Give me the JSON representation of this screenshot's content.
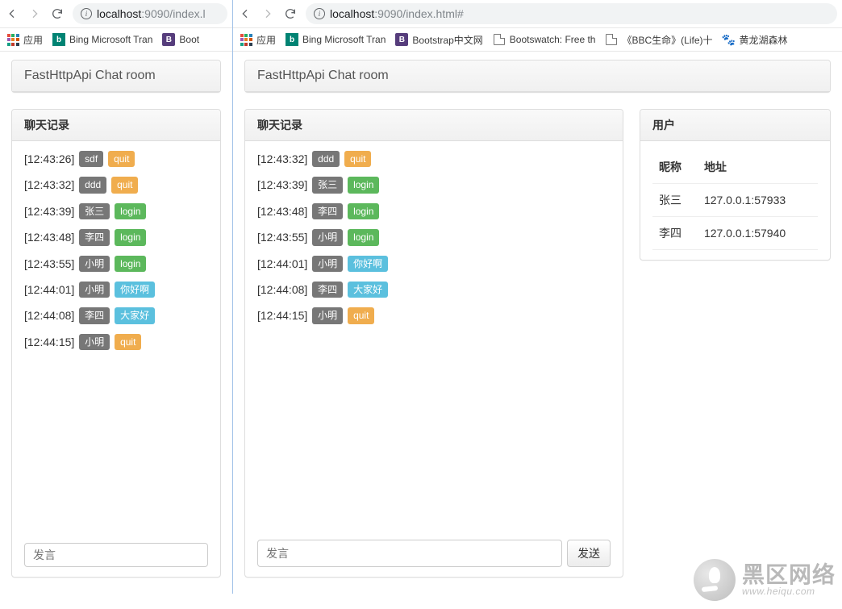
{
  "left": {
    "url_host": "localhost",
    "url_rest": ":9090/index.l",
    "bookmarks": [
      {
        "icon": "grid",
        "label": "应用"
      },
      {
        "icon": "bing",
        "label": "Bing Microsoft Tran"
      },
      {
        "icon": "B",
        "label": "Boot"
      }
    ],
    "title": "FastHttpApi Chat room",
    "chat_heading": "聊天记录",
    "messages": [
      {
        "time": "[12:43:26]",
        "user": "sdf",
        "action": "quit",
        "cls": "bg-orange"
      },
      {
        "time": "[12:43:32]",
        "user": "ddd",
        "action": "quit",
        "cls": "bg-orange"
      },
      {
        "time": "[12:43:39]",
        "user": "张三",
        "action": "login",
        "cls": "bg-green"
      },
      {
        "time": "[12:43:48]",
        "user": "李四",
        "action": "login",
        "cls": "bg-green"
      },
      {
        "time": "[12:43:55]",
        "user": "小明",
        "action": "login",
        "cls": "bg-green"
      },
      {
        "time": "[12:44:01]",
        "user": "小明",
        "action": "你好啊",
        "cls": "bg-cyan"
      },
      {
        "time": "[12:44:08]",
        "user": "李四",
        "action": "大家好",
        "cls": "bg-cyan"
      },
      {
        "time": "[12:44:15]",
        "user": "小明",
        "action": "quit",
        "cls": "bg-orange"
      }
    ],
    "input_placeholder": "发言"
  },
  "right": {
    "url_host": "localhost",
    "url_rest": ":9090/index.html#",
    "bookmarks": [
      {
        "icon": "grid",
        "label": "应用"
      },
      {
        "icon": "bing",
        "label": "Bing Microsoft Tran"
      },
      {
        "icon": "B",
        "label": "Bootstrap中文网"
      },
      {
        "icon": "doc",
        "label": "Bootswatch: Free th"
      },
      {
        "icon": "doc",
        "label": "《BBC生命》(Life)十"
      },
      {
        "icon": "paw",
        "label": "黄龙湖森林"
      }
    ],
    "title": "FastHttpApi Chat room",
    "chat_heading": "聊天记录",
    "users_heading": "用户",
    "messages": [
      {
        "time": "[12:43:32]",
        "user": "ddd",
        "action": "quit",
        "cls": "bg-orange"
      },
      {
        "time": "[12:43:39]",
        "user": "张三",
        "action": "login",
        "cls": "bg-green"
      },
      {
        "time": "[12:43:48]",
        "user": "李四",
        "action": "login",
        "cls": "bg-green"
      },
      {
        "time": "[12:43:55]",
        "user": "小明",
        "action": "login",
        "cls": "bg-green"
      },
      {
        "time": "[12:44:01]",
        "user": "小明",
        "action": "你好啊",
        "cls": "bg-cyan"
      },
      {
        "time": "[12:44:08]",
        "user": "李四",
        "action": "大家好",
        "cls": "bg-cyan"
      },
      {
        "time": "[12:44:15]",
        "user": "小明",
        "action": "quit",
        "cls": "bg-orange"
      }
    ],
    "input_placeholder": "发言",
    "send_label": "发送",
    "users_cols": [
      "昵称",
      "地址"
    ],
    "users": [
      {
        "name": "张三",
        "addr": "127.0.0.1:57933"
      },
      {
        "name": "李四",
        "addr": "127.0.0.1:57940"
      }
    ]
  },
  "watermark": {
    "big": "黑区网络",
    "small": "www.heiqu.com"
  }
}
